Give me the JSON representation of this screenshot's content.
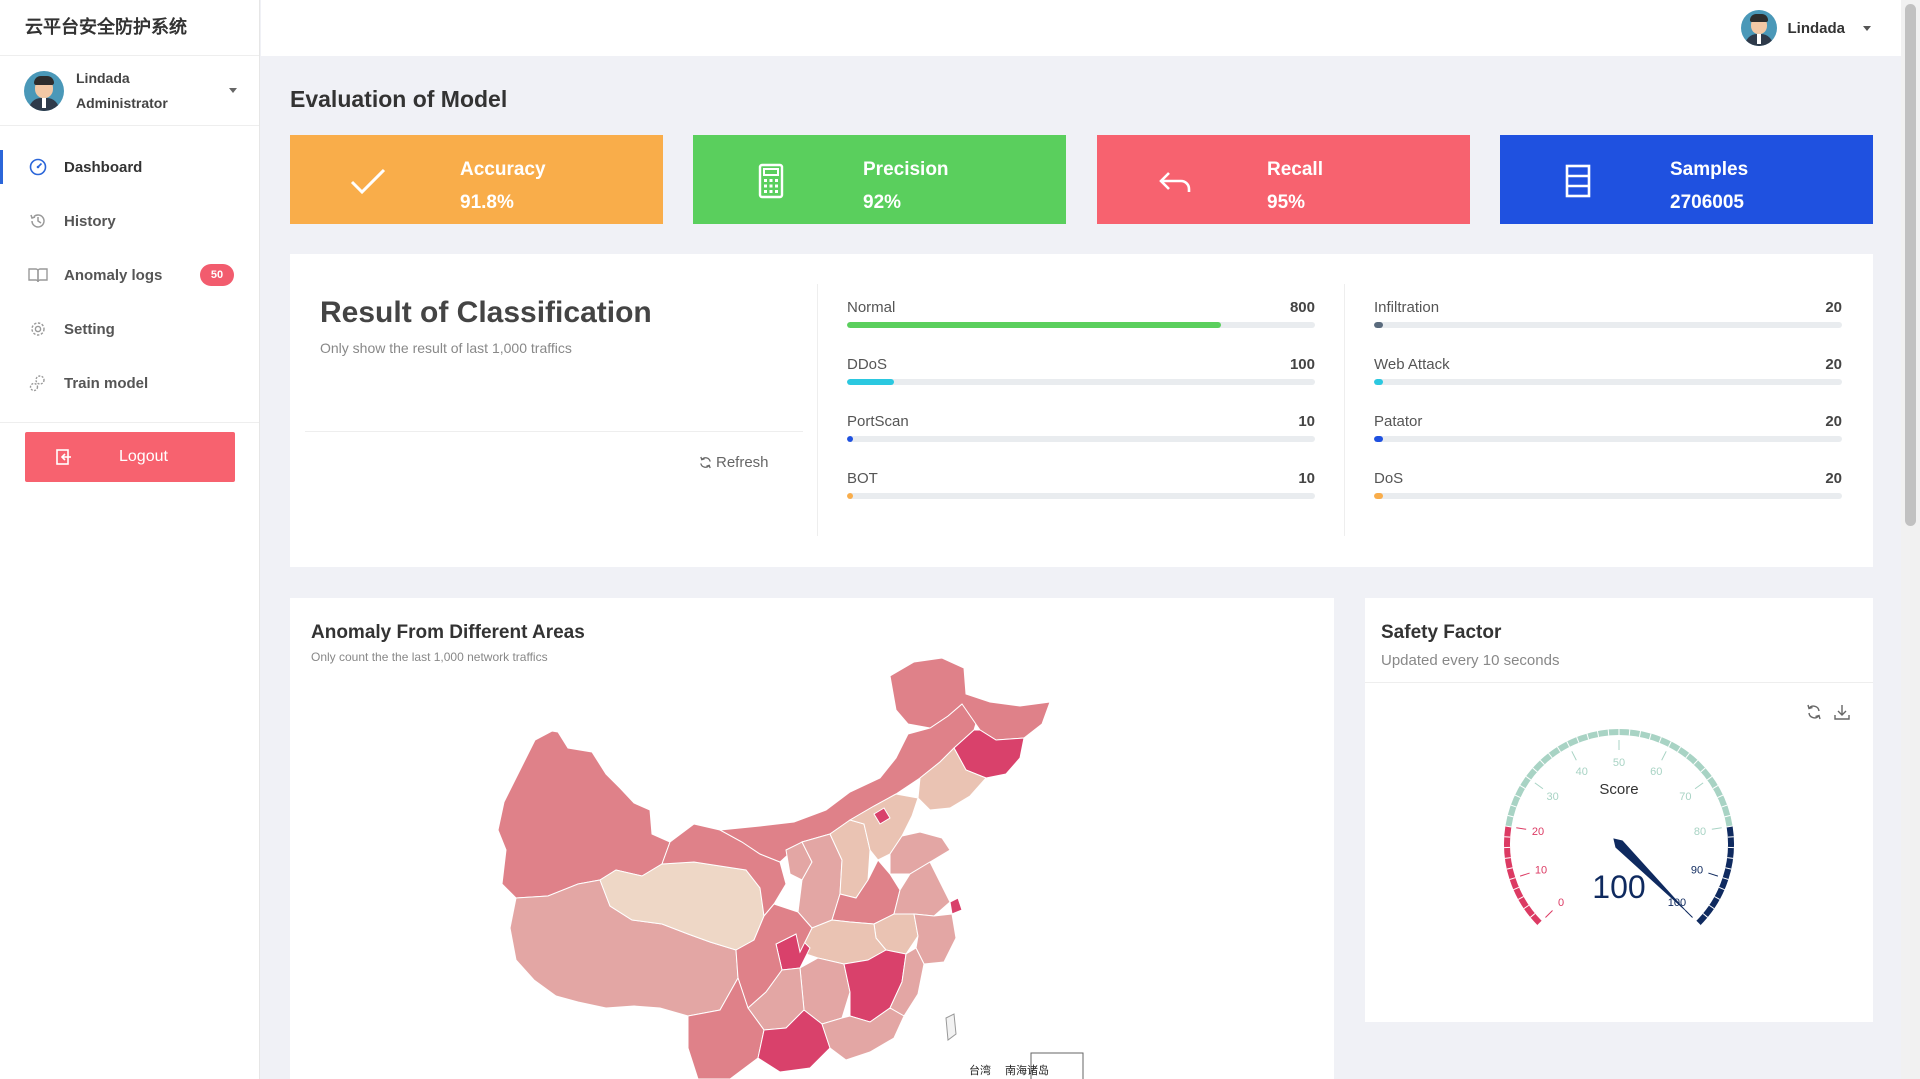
{
  "app": {
    "brand": "云平台安全防护系统"
  },
  "user": {
    "name": "Lindada",
    "role": "Administrator"
  },
  "sidebar": {
    "items": [
      {
        "label": "Dashboard",
        "icon": "dashboard-icon",
        "active": true
      },
      {
        "label": "History",
        "icon": "history-icon"
      },
      {
        "label": "Anomaly logs",
        "icon": "book-icon",
        "badge": "50"
      },
      {
        "label": "Setting",
        "icon": "gear-icon"
      },
      {
        "label": "Train model",
        "icon": "gears-icon"
      }
    ],
    "logout_label": "Logout"
  },
  "page": {
    "title": "Evaluation of Model"
  },
  "stats": [
    {
      "label": "Accuracy",
      "value": "91.8%",
      "color": "#f9ad4a",
      "icon": "check-icon"
    },
    {
      "label": "Precision",
      "value": "92%",
      "color": "#5acf5d",
      "icon": "calculator-icon"
    },
    {
      "label": "Recall",
      "value": "95%",
      "color": "#f7626f",
      "icon": "reply-icon"
    },
    {
      "label": "Samples",
      "value": "2706005",
      "color": "#1f51e0",
      "icon": "list-icon"
    }
  ],
  "classification": {
    "title": "Result of Classification",
    "subtitle": "Only show the result of last 1,000 traffics",
    "refresh_label": "Refresh",
    "items": [
      {
        "label": "Normal",
        "value": "800",
        "fraction": 0.8,
        "color": "#5acf5d"
      },
      {
        "label": "DDoS",
        "value": "100",
        "fraction": 0.1,
        "color": "#2bc8e0"
      },
      {
        "label": "PortScan",
        "value": "10",
        "fraction": 0.01,
        "color": "#1f51e0"
      },
      {
        "label": "BOT",
        "value": "10",
        "fraction": 0.01,
        "color": "#f9ad4a"
      },
      {
        "label": "Infiltration",
        "value": "20",
        "fraction": 0.02,
        "color": "#5a6b7d"
      },
      {
        "label": "Web Attack",
        "value": "20",
        "fraction": 0.02,
        "color": "#2bc8e0"
      },
      {
        "label": "Patator",
        "value": "20",
        "fraction": 0.02,
        "color": "#1f51e0"
      },
      {
        "label": "DoS",
        "value": "20",
        "fraction": 0.02,
        "color": "#f9ad4a"
      }
    ]
  },
  "map": {
    "title": "Anomaly From Different Areas",
    "subtitle": "Only count the the last 1,000 network traffics",
    "labels": [
      "台湾",
      "南海诸岛"
    ]
  },
  "safety": {
    "title": "Safety Factor",
    "subtitle": "Updated every 10 seconds",
    "gauge": {
      "name": "Score",
      "value": 100,
      "display_value": "100",
      "min": 0,
      "max": 100,
      "ticks": [
        "0",
        "10",
        "20",
        "30",
        "40",
        "50",
        "60",
        "70",
        "80",
        "90",
        "100"
      ]
    }
  }
}
